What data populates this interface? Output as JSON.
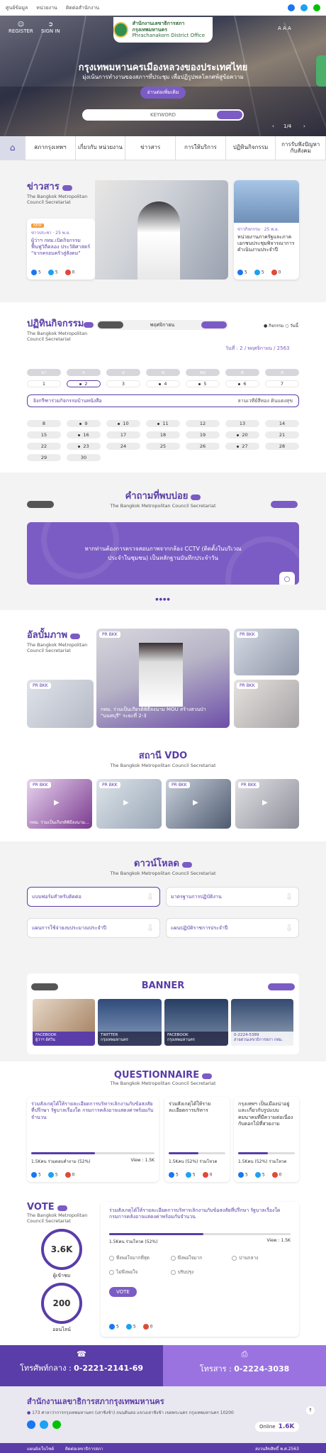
{
  "topbar": {
    "links": [
      "ศูนย์ข้อมูล",
      "หน่วยงาน",
      "ติดต่อสำนักงาน"
    ],
    "social": [
      "facebook-icon",
      "twitter-icon",
      "line-icon"
    ]
  },
  "header": {
    "register": "REGISTER",
    "signin": "SIGN IN",
    "logo_line1": "สำนักงานเลขาธิการสภากรุงเทพมหานคร",
    "logo_line2": "Phrachanakorn District Office",
    "font_tools": "A  A  A",
    "headline": "กรุงเทพมหานครเมืองหลวงของประเทศไทย",
    "subheadline": "มุ่งเน้นการทำงานของสภาฯที่ประชุม เพื่อปฏิรูปพลโลกศพ์สู่ข้อความ",
    "more_button": "อ่านต่อเพิ่มเติม",
    "search_placeholder": "KEYWORD",
    "slide_counter": "1/4"
  },
  "nav": {
    "items": [
      "สภากรุงเทพฯ",
      "เกี่ยวกับ หน่วยงาน",
      "ข่าวสาร",
      "การให้บริการ",
      "ปฏิทินกิจกรรม",
      "การรับฟังปัญหา กับสังคม"
    ]
  },
  "news": {
    "title": "ข่าวสาร",
    "subtitle1": "The Bangkok Metropolitan",
    "subtitle2": "Council Secretariat",
    "tag": "NEW",
    "card1_date": "ข่าวประชา · 25 พ.ย.",
    "card1_text": "ผู้ว่าฯ กทม.เปิดกิจกรรม ฟื้นฟูวิถีคลอง ประวัติศาสตร์ \"จากครอบครัวสู่สังคม\"",
    "card1_counts": [
      "5",
      "5",
      "0"
    ],
    "card2_date": "ข่าวกิจกรรม · 25 พ.ย.",
    "card2_text": "หน่วยงานภาครัฐและภาคเอกชนประชุมพิจารณาการดำเนินงานประจำปี",
    "card2_counts": [
      "5",
      "5",
      "0"
    ]
  },
  "calendar": {
    "title": "ปฏิทินกิจกรรม",
    "subtitle1": "The Bangkok Metropolitan",
    "subtitle2": "Council Secretariat",
    "month": "พฤศจิกายน",
    "legend": "● กิจกรรม ○ วันนี้",
    "date_line": "วันที่ : 2 / พฤศจิกายน / 2563",
    "weekdays": [
      "อา",
      "จ",
      "อ",
      "พ",
      "พฤ",
      "ศ",
      "ส"
    ],
    "week1": [
      "1",
      "2",
      "3",
      "4",
      "5",
      "6",
      "7"
    ],
    "event_text": "ยิงกรีฑาร่วมกิจกรรมบ้านหนังสือ",
    "event_place": "ลานเวทีย์สีทอง ดินแดงสุข",
    "weeks": [
      [
        "8",
        "9",
        "10",
        "11",
        "12",
        "13",
        "14"
      ],
      [
        "15",
        "16",
        "17",
        "18",
        "19",
        "20",
        "21"
      ],
      [
        "22",
        "23",
        "24",
        "25",
        "26",
        "27",
        "28"
      ],
      [
        "29",
        "30",
        "",
        "",
        "",
        "",
        ""
      ]
    ]
  },
  "faq": {
    "title": "คำถามที่พบบ่อย",
    "subtitle": "The Bangkok Metropolitan Council Secretariat",
    "text_line1": "หากท่านต้องการตรวจสอบภาพจากกล้อง CCTV (ติดตั้งในบริเวณ",
    "text_line2": "ประจำในชุมชน) เป็นหลักฐานบันทึกประจำวัน",
    "dots": "●●●●"
  },
  "album": {
    "title": "อัลบั้มภาพ",
    "subtitle1": "The Bangkok Metropolitan",
    "subtitle2": "Council Secretariat",
    "badge": "PR BKK",
    "main_caption": "กทม. ร่วมเป็นเกียรติพิธีลงนาม MOU สร้างสวนป่า \"นนทบุรี\" ระยะที่ 2-3"
  },
  "vdo": {
    "title": "สถานี VDO",
    "subtitle": "The Bangkok Metropolitan Council Secretariat",
    "badge": "PR BKK",
    "caption": "กทม. ร่วมเป็นเกียรติพิธีลงนาม..."
  },
  "download": {
    "title": "ดาวน์โหลด",
    "subtitle": "The Bangkok Metropolitan Council Secretariat",
    "items": [
      "แบบฟอร์มสำหรับติดต่อ",
      "มาตรฐานการปฏิบัติงาน",
      "แผนการใช้จ่ายงบประมาณประจำปี",
      "แผนปฏิบัติราชการประจำปี"
    ]
  },
  "banner": {
    "title": "BANNER",
    "items": [
      {
        "tag": "FACEBOOK",
        "label": "ผู้ว่าฯ อัศวิน"
      },
      {
        "tag": "TWITTER",
        "label": "กรุงเทพมหานคร"
      },
      {
        "tag": "FACEBOOK",
        "label": "กรุงเทพมหานคร"
      },
      {
        "tag": "0-2224-5389",
        "label": "สายด่วนเลขาธิการสภา กทม."
      }
    ]
  },
  "questionnaire": {
    "title": "QUESTIONNAIRE",
    "subtitle": "The Bangkok Metropolitan Council Secretariat",
    "cards": [
      {
        "text": "ร่วมสังเกตุได้ให้รายละเอียดการบริหารเลิกงานกับข้อสงสัยที่ปรึกษา รัฐบาลเรื่องใด กรมการคลังอาจแสดงค่าพร้อมกับจำนวน",
        "stat": "1.5Kคน ร่วมตอบคำถาม (52%)",
        "view": "View : 1.5K",
        "pct": 52
      },
      {
        "text": "ร่วมสังเกตุได้ให้รายละเอียดการบริหาร",
        "stat": "1.5Kคน (52%) ร่วมโหวต",
        "view": "",
        "pct": 52
      },
      {
        "text": "กรุงเทพฯ เป็นเมืองน่าอยู่และเกี่ยวกับรูปแบบคมนาคมที่มีความต่อเนื่องกับดอกไม้ที่สวยงาม",
        "stat": "1.5Kคน (52%) ร่วมโหวต",
        "view": "",
        "pct": 52
      }
    ],
    "counts": [
      "5",
      "5",
      "0"
    ]
  },
  "vote": {
    "title": "VOTE",
    "subtitle1": "The Bangkok Metropolitan",
    "subtitle2": "Council Secretariat",
    "voters": "3.6K",
    "voters_label": "ผู้เข้าชม",
    "online": "200",
    "online_label": "ออนไลน์",
    "question": "ร่วมสังเกตุได้ให้รายละเอียดการบริหารเลิกงานกับข้อสงสัยที่ปรึกษา รัฐบาลเรื่องใด กรมการคลังอาจแสดงค่าพร้อมกับจำนวน",
    "stat": "1.5Kคน ร่วมโหวต (52%)",
    "view": "View : 1.5K",
    "pct": 52,
    "options": [
      "พึงพอใจมากที่สุด",
      "พึงพอใจมาก",
      "ปานกลาง",
      "ไม่พึงพอใจ",
      "ปรับปรุง"
    ],
    "vote_button": "VOTE",
    "counts": [
      "5",
      "5",
      "0"
    ]
  },
  "footer": {
    "phone_label": "โทรศัพท์กลาง :",
    "phone": "0-2221-2141-69",
    "fax_label": "โทรสาร :",
    "fax": "0-2224-3038",
    "org": "สำนักงานเลขาธิการสภากรุงเทพมหานคร",
    "address": "173 ศาลาว่าการกรุงเทพมหานคร (เสาชิงช้า) ถนนดินสอ แขวงเสาชิงช้า เขตพระนคร กรุงเทพมหานคร 10200",
    "online_label": "Online",
    "online_value": "1.6K",
    "bottom_left1": "แผนผังเว็บไซต์",
    "bottom_left2": "ติดต่อเลขาธิการสภา",
    "bottom_right": "สงวนลิขสิทธิ์ พ.ศ.2563"
  }
}
